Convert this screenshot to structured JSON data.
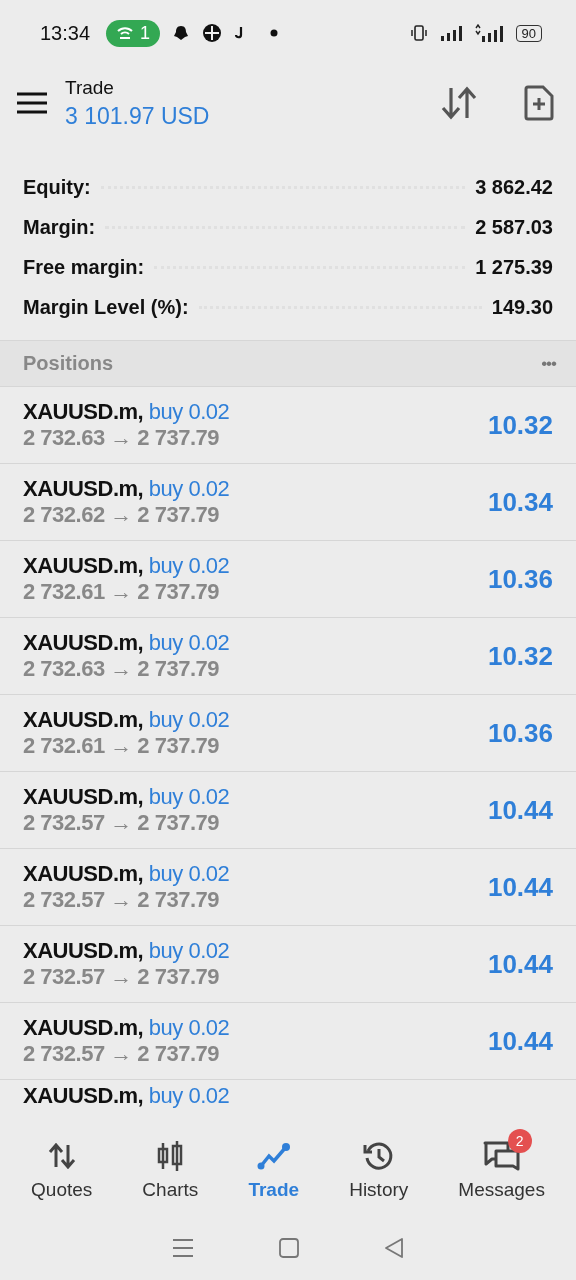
{
  "status_bar": {
    "time": "13:34",
    "hotspot_count": "1",
    "battery": "90"
  },
  "header": {
    "title": "Trade",
    "balance": "3 101.97 USD"
  },
  "summary": [
    {
      "label": "Equity:",
      "value": "3 862.42"
    },
    {
      "label": "Margin:",
      "value": "2 587.03"
    },
    {
      "label": "Free margin:",
      "value": "1 275.39"
    },
    {
      "label": "Margin Level (%):",
      "value": "149.30"
    }
  ],
  "positions": {
    "title": "Positions",
    "more": "•••",
    "rows": [
      {
        "symbol": "XAUUSD.m,",
        "side": "buy 0.02",
        "prices": "2 732.63 → 2 737.79",
        "profit": "10.32"
      },
      {
        "symbol": "XAUUSD.m,",
        "side": "buy 0.02",
        "prices": "2 732.62 → 2 737.79",
        "profit": "10.34"
      },
      {
        "symbol": "XAUUSD.m,",
        "side": "buy 0.02",
        "prices": "2 732.61 → 2 737.79",
        "profit": "10.36"
      },
      {
        "symbol": "XAUUSD.m,",
        "side": "buy 0.02",
        "prices": "2 732.63 → 2 737.79",
        "profit": "10.32"
      },
      {
        "symbol": "XAUUSD.m,",
        "side": "buy 0.02",
        "prices": "2 732.61 → 2 737.79",
        "profit": "10.36"
      },
      {
        "symbol": "XAUUSD.m,",
        "side": "buy 0.02",
        "prices": "2 732.57 → 2 737.79",
        "profit": "10.44"
      },
      {
        "symbol": "XAUUSD.m,",
        "side": "buy 0.02",
        "prices": "2 732.57 → 2 737.79",
        "profit": "10.44"
      },
      {
        "symbol": "XAUUSD.m,",
        "side": "buy 0.02",
        "prices": "2 732.57 → 2 737.79",
        "profit": "10.44"
      },
      {
        "symbol": "XAUUSD.m,",
        "side": "buy 0.02",
        "prices": "2 732.57 → 2 737.79",
        "profit": "10.44"
      },
      {
        "symbol": "XAUUSD.m,",
        "side": "buy 0.02"
      }
    ]
  },
  "nav": [
    {
      "label": "Quotes",
      "kind": "quotes",
      "selected": false
    },
    {
      "label": "Charts",
      "kind": "charts",
      "selected": false
    },
    {
      "label": "Trade",
      "kind": "trade",
      "selected": true
    },
    {
      "label": "History",
      "kind": "history",
      "selected": false
    },
    {
      "label": "Messages",
      "kind": "messages",
      "selected": false,
      "badge": "2"
    }
  ]
}
